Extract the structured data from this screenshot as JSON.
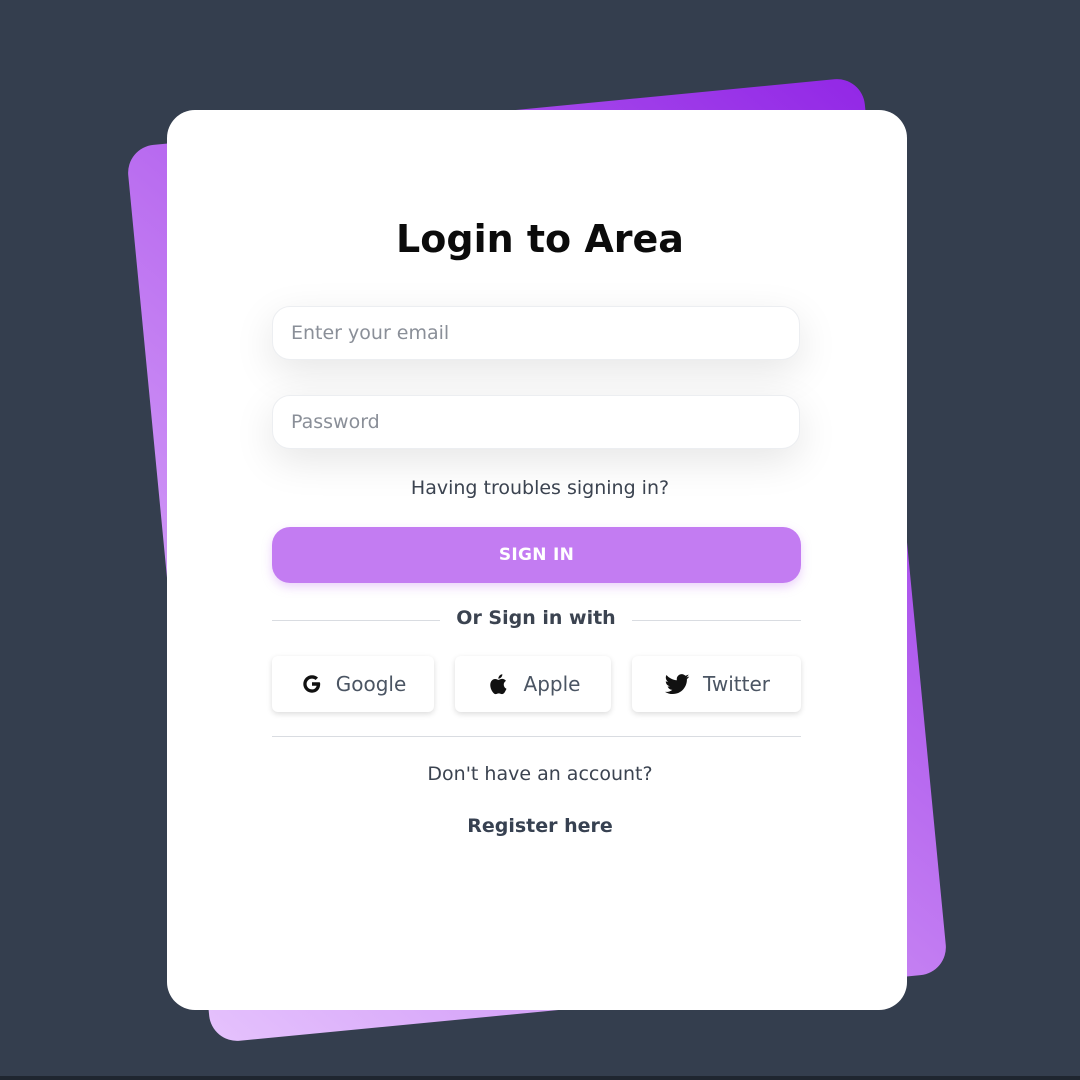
{
  "login": {
    "title": "Login to Area",
    "email_placeholder": "Enter your email",
    "password_placeholder": "Password",
    "trouble_link": "Having troubles signing in?",
    "signin_label": "SIGN IN",
    "divider_text": "Or Sign in with",
    "social": [
      {
        "label": "Google",
        "icon": "google-icon"
      },
      {
        "label": "Apple",
        "icon": "apple-icon"
      },
      {
        "label": "Twitter",
        "icon": "twitter-icon"
      }
    ],
    "no_account_text": "Don't have an account?",
    "register_link": "Register here"
  },
  "colors": {
    "background": "#343e4e",
    "accent": "#c37cf2",
    "accent_dark": "#9227e6",
    "card": "#ffffff"
  }
}
